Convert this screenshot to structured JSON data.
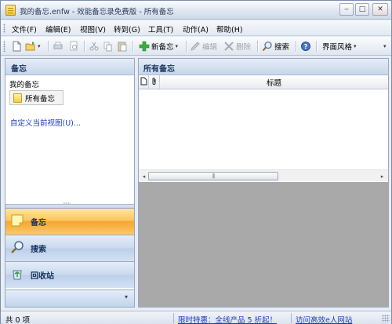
{
  "window": {
    "title": "我的备忘.enfw - 效能备忘录免费版 - 所有备忘",
    "minimize_label": "‒",
    "maximize_label": "□",
    "close_label": "✕"
  },
  "menu": {
    "items": [
      {
        "label": "文件(F)"
      },
      {
        "label": "编辑(E)"
      },
      {
        "label": "视图(V)"
      },
      {
        "label": "转到(G)"
      },
      {
        "label": "工具(T)"
      },
      {
        "label": "动作(A)"
      },
      {
        "label": "帮助(H)"
      }
    ]
  },
  "toolbar": {
    "new_note_label": "新备忘",
    "edit_label": "编辑",
    "delete_label": "删除",
    "search_label": "搜索",
    "theme_label": "界面风格",
    "dropdown_glyph": "▾",
    "overflow_glyph": "▾"
  },
  "sidebar": {
    "header": "备忘",
    "tree_title": "我的备忘",
    "tree_node_label": "所有备忘",
    "customize_link": "自定义当前视图(U)...",
    "nav": [
      {
        "label": "备忘",
        "icon": "note-icon",
        "active": true
      },
      {
        "label": "搜索",
        "icon": "magnifier-icon",
        "active": false
      },
      {
        "label": "回收站",
        "icon": "recycle-icon",
        "active": false
      }
    ],
    "footer_chevron": "▾"
  },
  "main": {
    "header": "所有备忘",
    "columns": [
      {
        "icon": "document-icon"
      },
      {
        "icon": "attachment-icon"
      },
      {
        "label": "标题"
      }
    ],
    "scroll_left": "◂",
    "scroll_right": "▸",
    "thumb_grip": "|||"
  },
  "status": {
    "count_text": "共 0 项",
    "promo_link": "限时特惠：全线产品 5 折起！",
    "site_link": "访问高效e人网站"
  },
  "colors": {
    "active_nav": "#f6a632",
    "link": "#1d3bbd",
    "header_text": "#15305a",
    "preview_background": "#a9a9a9"
  }
}
